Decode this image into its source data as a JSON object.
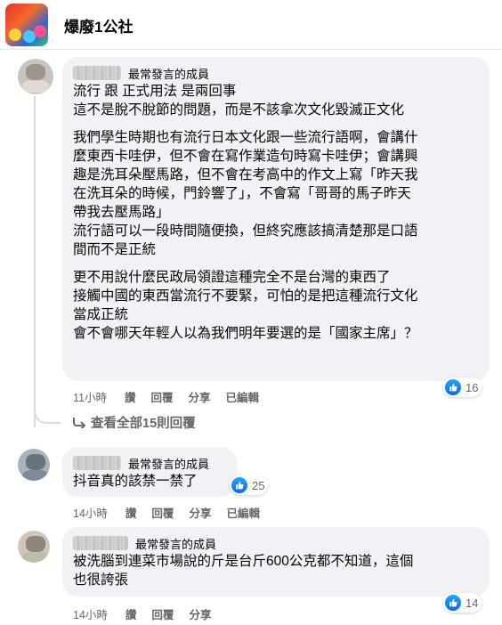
{
  "group": {
    "name": "爆廢1公社"
  },
  "comments": [
    {
      "badge": "最常發言的成員",
      "paragraphs": [
        "流行 跟 正式用法 是兩回事\n這不是脫不脫節的問題，而是不該拿次文化毀滅正文化",
        "我們學生時期也有流行日本文化跟一些流行語啊，會講什\n麼東西卡哇伊，但不會在寫作業造句時寫卡哇伊；會講興\n趣是洗耳朵壓馬路，但不會在考高中的作文上寫「昨天我\n在洗耳朵的時候，門鈴響了」，不會寫「哥哥的馬子昨天\n帶我去壓馬路」\n流行語可以一段時間隨便換，但終究應該搞清楚那是口語\n間而不是正統",
        "更不用說什麼民政局領證這種完全不是台灣的東西了\n接觸中國的東西當流行不要緊，可怕的是把這種流行文化\n當成正統\n會不會哪天年輕人以為我們明年要選的是「國家主席」？"
      ],
      "time": "11小時",
      "like_label": "讚",
      "reply_label": "回覆",
      "share_label": "分享",
      "edited_label": "已編輯",
      "reactions": "16"
    },
    {
      "badge": "最常發言的成員",
      "paragraphs": [
        "抖音真的該禁一禁了"
      ],
      "time": "14小時",
      "like_label": "讚",
      "reply_label": "回覆",
      "share_label": "分享",
      "edited_label": "已編輯",
      "reactions": "25"
    },
    {
      "badge": "最常發言的成員",
      "paragraphs": [
        "被洗腦到連菜市場說的斤是台斤600公克都不知道，這個\n也很誇張"
      ],
      "time": "14小時",
      "like_label": "讚",
      "reply_label": "回覆",
      "share_label": "分享",
      "reactions": "14"
    }
  ],
  "view_more": "查看全部15則回覆",
  "colors": {
    "like_blue": "#0866ff",
    "bubble": "#f0f2f5",
    "meta_gray": "#65676b"
  },
  "icons": {
    "like": "thumbs-up-icon",
    "reply_arrow": "reply-arrow-icon"
  }
}
